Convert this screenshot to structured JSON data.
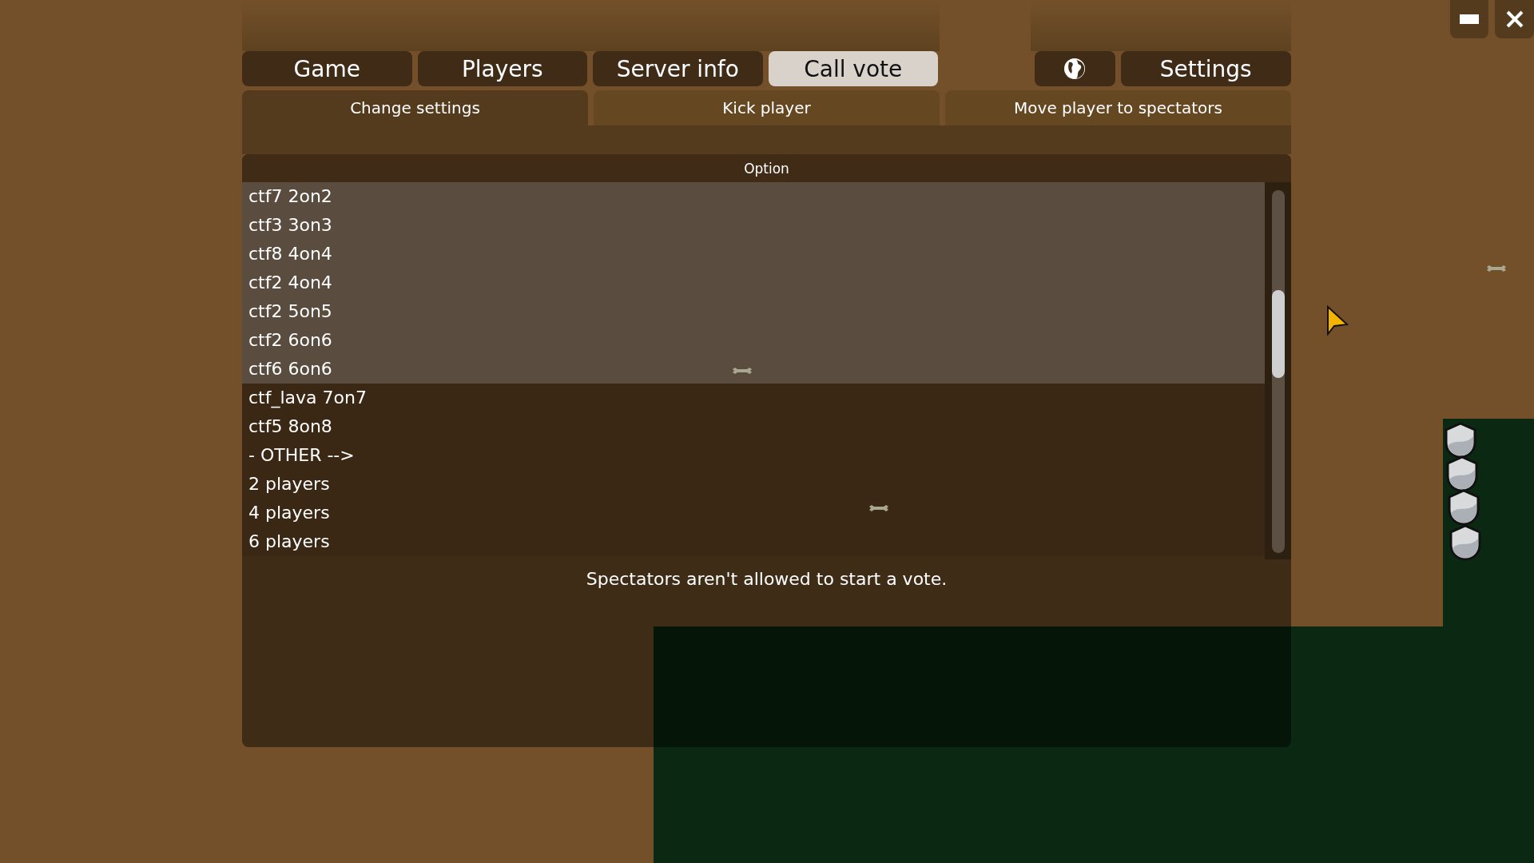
{
  "main_tabs": [
    {
      "kind": "text",
      "label": "Game",
      "selected": false
    },
    {
      "kind": "text",
      "label": "Players",
      "selected": false
    },
    {
      "kind": "text",
      "label": "Server info",
      "selected": false
    },
    {
      "kind": "text",
      "label": "Call vote",
      "selected": true
    }
  ],
  "side_tabs": [
    {
      "kind": "globe",
      "selected": false
    },
    {
      "kind": "text",
      "label": "Settings",
      "selected": false
    }
  ],
  "vote_tabs": [
    {
      "label": "Change settings",
      "selected": true
    },
    {
      "label": "Kick player",
      "selected": false
    },
    {
      "label": "Move player to spectators",
      "selected": false
    }
  ],
  "table": {
    "column": "Option",
    "rows": [
      {
        "label": "ctf7 2on2",
        "selected": true
      },
      {
        "label": "ctf3 3on3",
        "selected": true
      },
      {
        "label": "ctf8 4on4",
        "selected": true
      },
      {
        "label": "ctf2 4on4",
        "selected": true
      },
      {
        "label": "ctf2 5on5",
        "selected": true
      },
      {
        "label": "ctf2 6on6",
        "selected": true
      },
      {
        "label": "ctf6 6on6",
        "selected": true
      },
      {
        "label": "ctf_lava 7on7",
        "selected": false
      },
      {
        "label": "ctf5 8on8",
        "selected": false
      },
      {
        "label": "- OTHER -->",
        "selected": false
      },
      {
        "label": "2 players",
        "selected": false
      },
      {
        "label": "4 players",
        "selected": false
      },
      {
        "label": "6 players",
        "selected": false
      }
    ]
  },
  "message": "Spectators aren't allowed to start a vote."
}
